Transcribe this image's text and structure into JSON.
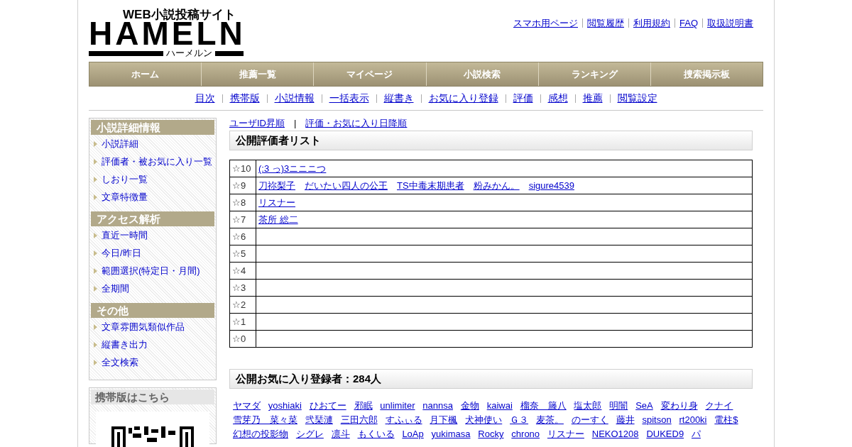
{
  "logo": {
    "tagline": "WEB小説投稿サイト",
    "name": "HAMELN",
    "reading": "ハーメルン"
  },
  "header_links": [
    "スマホ用ページ",
    "閲覧履歴",
    "利用規約",
    "FAQ",
    "取扱説明書"
  ],
  "nav": [
    "ホーム",
    "推薦一覧",
    "マイページ",
    "小説検索",
    "ランキング",
    "捜索掲示板"
  ],
  "sub_nav": [
    "目次",
    "携帯版",
    "小説情報",
    "一括表示",
    "縦書き",
    "お気に入り登録",
    "評価",
    "感想",
    "推薦",
    "閲覧設定"
  ],
  "sidebar": {
    "sections": [
      {
        "title": "小説詳細情報",
        "items": [
          "小説詳細",
          "評価者・被お気に入り一覧",
          "しおり一覧",
          "文章特徴量"
        ]
      },
      {
        "title": "アクセス解析",
        "items": [
          "直近一時間",
          "今日/昨日",
          "範囲選択(特定日・月間)",
          "全期間"
        ]
      },
      {
        "title": "その他",
        "items": [
          "文章雰囲気類似作品",
          "縦書き出力",
          "全文検索"
        ]
      }
    ],
    "mobile_box": {
      "title": "携帯版はこちら"
    }
  },
  "sort_links": [
    "ユーザID昇順",
    "評価・お気に入り日降順"
  ],
  "sort_separator": "|",
  "raters": {
    "title": "公開評価者リスト",
    "rows": [
      {
        "score": "☆10",
        "users": [
          "(:3 っ)3ニニニつ"
        ]
      },
      {
        "score": "☆9",
        "users": [
          "刀祢梨子",
          "だいたい四人の公王",
          "TS中毒末期患者",
          "粉みかん。",
          "sigure4539"
        ]
      },
      {
        "score": "☆8",
        "users": [
          "リスナー"
        ]
      },
      {
        "score": "☆7",
        "users": [
          "茶所 総二"
        ]
      },
      {
        "score": "☆6",
        "users": []
      },
      {
        "score": "☆5",
        "users": []
      },
      {
        "score": "☆4",
        "users": []
      },
      {
        "score": "☆3",
        "users": []
      },
      {
        "score": "☆2",
        "users": []
      },
      {
        "score": "☆1",
        "users": []
      },
      {
        "score": "☆0",
        "users": []
      }
    ]
  },
  "favorites": {
    "title": "公開お気に入り登録者：284人",
    "users": [
      "ヤマダ",
      "yoshiaki",
      "ひおてー",
      "邪眠",
      "unlimiter",
      "nannsa",
      "金物",
      "kaiwai",
      "榴奈　籐八",
      "塩太郎",
      "明闇",
      "SeA",
      "変わり身",
      "クナイ",
      "雪芽乃　菜々菜",
      "弐琹漣",
      "三田六郎",
      "すふぃる",
      "月下楓",
      "犬神使い",
      "Ｇ３",
      "麦茶。",
      "のーすく",
      "藤井",
      "spitson",
      "rt200ki",
      "電柱$",
      "幻想の投影物",
      "シグレ",
      "凛斗",
      "もくいる",
      "LoAp",
      "yukimasa",
      "Rocky",
      "chrono",
      "リスナー",
      "NEKO1208",
      "DUKED9",
      "パ"
    ]
  }
}
